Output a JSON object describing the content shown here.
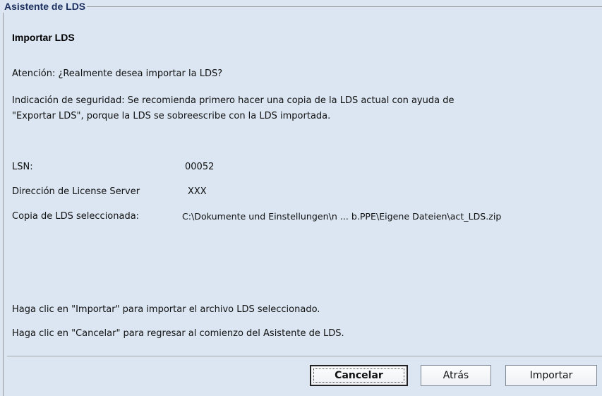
{
  "wizard": {
    "group_title": "Asistente de LDS",
    "section_title": "Importar LDS",
    "attention": "Atención: ¿Realmente desea importar la LDS?",
    "security_line1": "Indicación de seguridad: Se recomienda primero hacer una copia de la LDS actual con ayuda de",
    "security_line2": "\"Exportar LDS\", porque la LDS se sobreescribe con la LDS importada.",
    "fields": {
      "lsn_label": "LSN:",
      "lsn_value": "00052",
      "server_label": "Dirección de License Server",
      "server_value": "XXX",
      "copy_label": "Copia de LDS seleccionada:",
      "copy_value": "C:\\Dokumente und Einstellungen\\n ... b.PPE\\Eigene Dateien\\act_LDS.zip"
    },
    "hint_import": "Haga clic en \"Importar\" para importar el archivo LDS seleccionado.",
    "hint_cancel": "Haga clic en \"Cancelar\" para regresar al comienzo del Asistente de LDS."
  },
  "buttons": {
    "cancel": "Cancelar",
    "back": "Atrás",
    "import": "Importar"
  }
}
